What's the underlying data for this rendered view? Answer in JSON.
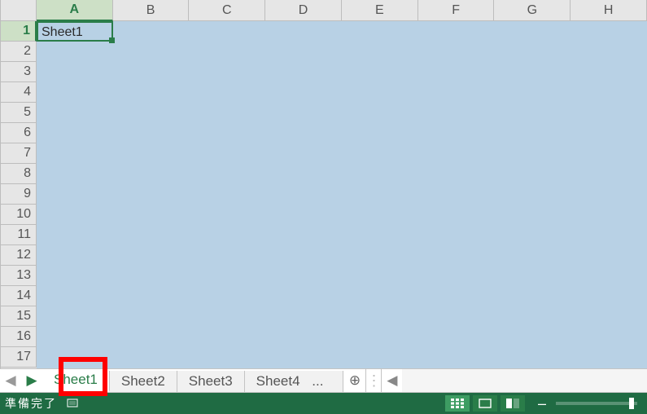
{
  "grid": {
    "columns": [
      "A",
      "B",
      "C",
      "D",
      "E",
      "F",
      "G",
      "H"
    ],
    "rows": [
      "1",
      "2",
      "3",
      "4",
      "5",
      "6",
      "7",
      "8",
      "9",
      "10",
      "11",
      "12",
      "13",
      "14",
      "15",
      "16",
      "17"
    ],
    "activeColumn": "A",
    "activeRow": "1",
    "activeCellValue": "Sheet1"
  },
  "tabs": {
    "navPrevGlyph": "◀",
    "navNextGlyph": "▶",
    "items": [
      "Sheet1",
      "Sheet2",
      "Sheet3",
      "Sheet4"
    ],
    "moreGlyph": "...",
    "addGlyph": "⊕",
    "dragDotsGlyph": "⋮",
    "hScrollLeftGlyph": "◀",
    "activeIndex": 0
  },
  "status": {
    "readyText": "準備完了",
    "zoomMinus": "–",
    "zoomThumbPercent": 90
  }
}
